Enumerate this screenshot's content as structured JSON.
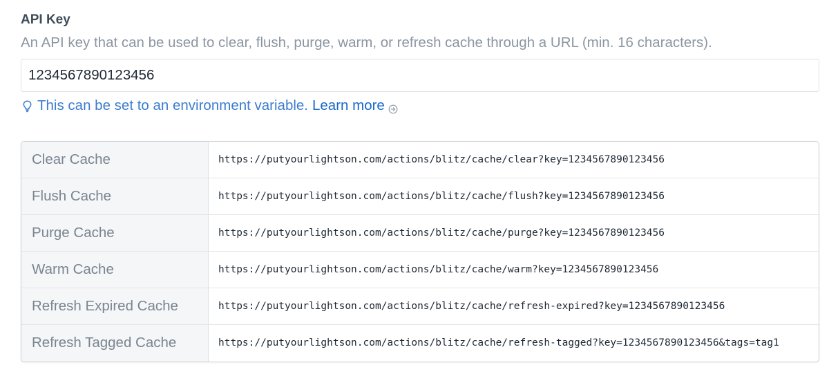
{
  "api_key_field": {
    "heading": "API Key",
    "instructions": "An API key that can be used to clear, flush, purge, warm, or refresh cache through a URL (min. 16 characters).",
    "value": "1234567890123456",
    "tip_text": "This can be set to an environment variable.",
    "learn_more_label": "Learn more"
  },
  "url_table": {
    "rows": [
      {
        "label": "Clear Cache",
        "url": "https://putyourlightson.com/actions/blitz/cache/clear?key=1234567890123456"
      },
      {
        "label": "Flush Cache",
        "url": "https://putyourlightson.com/actions/blitz/cache/flush?key=1234567890123456"
      },
      {
        "label": "Purge Cache",
        "url": "https://putyourlightson.com/actions/blitz/cache/purge?key=1234567890123456"
      },
      {
        "label": "Warm Cache",
        "url": "https://putyourlightson.com/actions/blitz/cache/warm?key=1234567890123456"
      },
      {
        "label": "Refresh Expired Cache",
        "url": "https://putyourlightson.com/actions/blitz/cache/refresh-expired?key=1234567890123456"
      },
      {
        "label": "Refresh Tagged Cache",
        "url": "https://putyourlightson.com/actions/blitz/cache/refresh-tagged?key=1234567890123456&tags=tag1"
      }
    ]
  },
  "icons": {
    "tip": "lightbulb-icon",
    "learn_more": "circle-arrow-right-icon"
  },
  "colors": {
    "link": "#1668c9",
    "tip": "#3b7ccf",
    "muted": "#8b96a2"
  }
}
